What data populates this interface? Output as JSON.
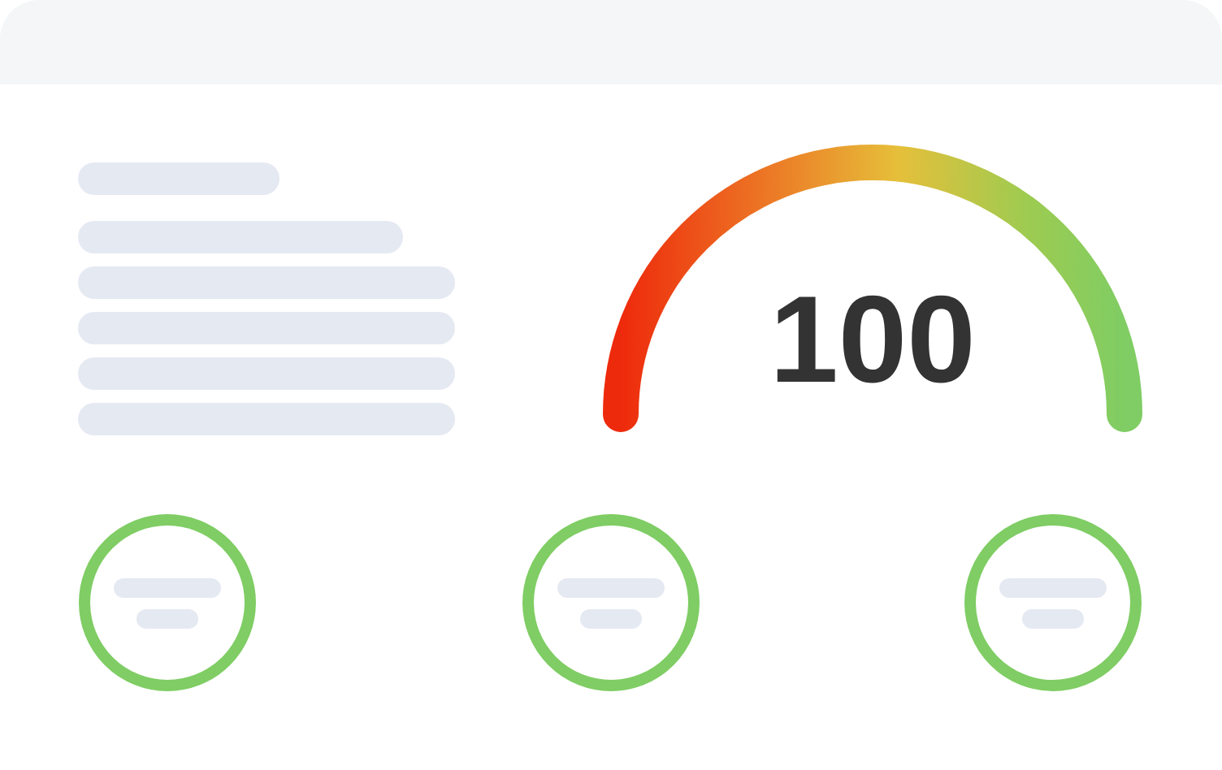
{
  "gauge": {
    "score": "100"
  },
  "metrics": [
    {
      "level": 1
    },
    {
      "level": 1
    },
    {
      "level": 1
    }
  ]
}
